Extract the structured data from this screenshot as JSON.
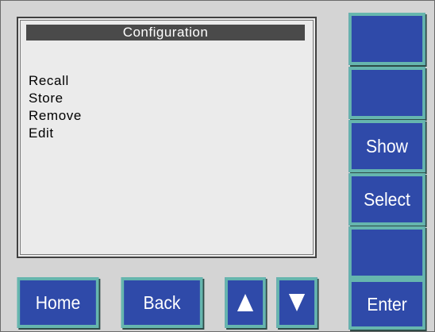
{
  "screen": {
    "title": "Configuration",
    "menu_items": [
      "Recall",
      "Store",
      "Remove",
      "Edit"
    ]
  },
  "side_buttons": [
    "",
    "",
    "Show",
    "Select",
    "",
    "Enter"
  ],
  "bottom_buttons": {
    "home": "Home",
    "back": "Back",
    "up_icon": "arrow-up-icon",
    "down_icon": "arrow-down-icon"
  },
  "colors": {
    "panel_bg": "#d4d4d4",
    "screen_bg": "#ebebeb",
    "title_bar": "#4a4a4a",
    "button_fill": "#2f4aa9",
    "button_border": "#66b6ae"
  }
}
